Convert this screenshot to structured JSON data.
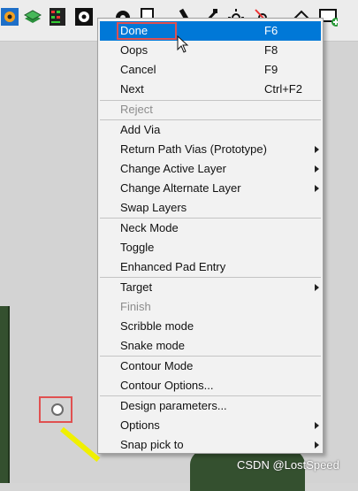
{
  "menu": {
    "items": [
      {
        "label": "Done",
        "shortcut": "F6",
        "submenu": false,
        "disabled": false,
        "selected": true
      },
      {
        "label": "Oops",
        "shortcut": "F8",
        "submenu": false,
        "disabled": false
      },
      {
        "label": "Cancel",
        "shortcut": "F9",
        "submenu": false,
        "disabled": false
      },
      {
        "label": "Next",
        "shortcut": "Ctrl+F2",
        "submenu": false,
        "disabled": false
      },
      {
        "label": "Reject",
        "shortcut": "",
        "submenu": false,
        "disabled": true
      },
      {
        "label": "Add Via",
        "shortcut": "",
        "submenu": false,
        "disabled": false
      },
      {
        "label": "Return Path Vias (Prototype)",
        "shortcut": "",
        "submenu": true,
        "disabled": false
      },
      {
        "label": "Change Active Layer",
        "shortcut": "",
        "submenu": true,
        "disabled": false
      },
      {
        "label": "Change Alternate Layer",
        "shortcut": "",
        "submenu": true,
        "disabled": false
      },
      {
        "label": "Swap Layers",
        "shortcut": "",
        "submenu": false,
        "disabled": false
      },
      {
        "label": "Neck Mode",
        "shortcut": "",
        "submenu": false,
        "disabled": false
      },
      {
        "label": "Toggle",
        "shortcut": "",
        "submenu": false,
        "disabled": false
      },
      {
        "label": "Enhanced Pad Entry",
        "shortcut": "",
        "submenu": false,
        "disabled": false
      },
      {
        "label": "Target",
        "shortcut": "",
        "submenu": true,
        "disabled": false
      },
      {
        "label": "Finish",
        "shortcut": "",
        "submenu": false,
        "disabled": true
      },
      {
        "label": "Scribble mode",
        "shortcut": "",
        "submenu": false,
        "disabled": false
      },
      {
        "label": "Snake mode",
        "shortcut": "",
        "submenu": false,
        "disabled": false
      },
      {
        "label": "Contour Mode",
        "shortcut": "",
        "submenu": false,
        "disabled": false
      },
      {
        "label": "Contour Options...",
        "shortcut": "",
        "submenu": false,
        "disabled": false
      },
      {
        "label": "Design parameters...",
        "shortcut": "",
        "submenu": false,
        "disabled": false
      },
      {
        "label": "Options",
        "shortcut": "",
        "submenu": true,
        "disabled": false
      },
      {
        "label": "Snap pick to",
        "shortcut": "",
        "submenu": true,
        "disabled": false
      }
    ]
  },
  "watermark": "CSDN @LostSpeed",
  "colors": {
    "selection": "#0078d7",
    "highlight_box": "#e05050",
    "trace": "#f0f000",
    "board": "#34502f"
  },
  "toolbar_icons": [
    "pad-stack-icon",
    "layers-icon",
    "database-icon",
    "settings-icon",
    "via-icon",
    "document-icon",
    "wrench-icon",
    "brush-icon",
    "sun-icon",
    "sun-disabled-icon",
    "shape-icon",
    "add-window-icon"
  ]
}
